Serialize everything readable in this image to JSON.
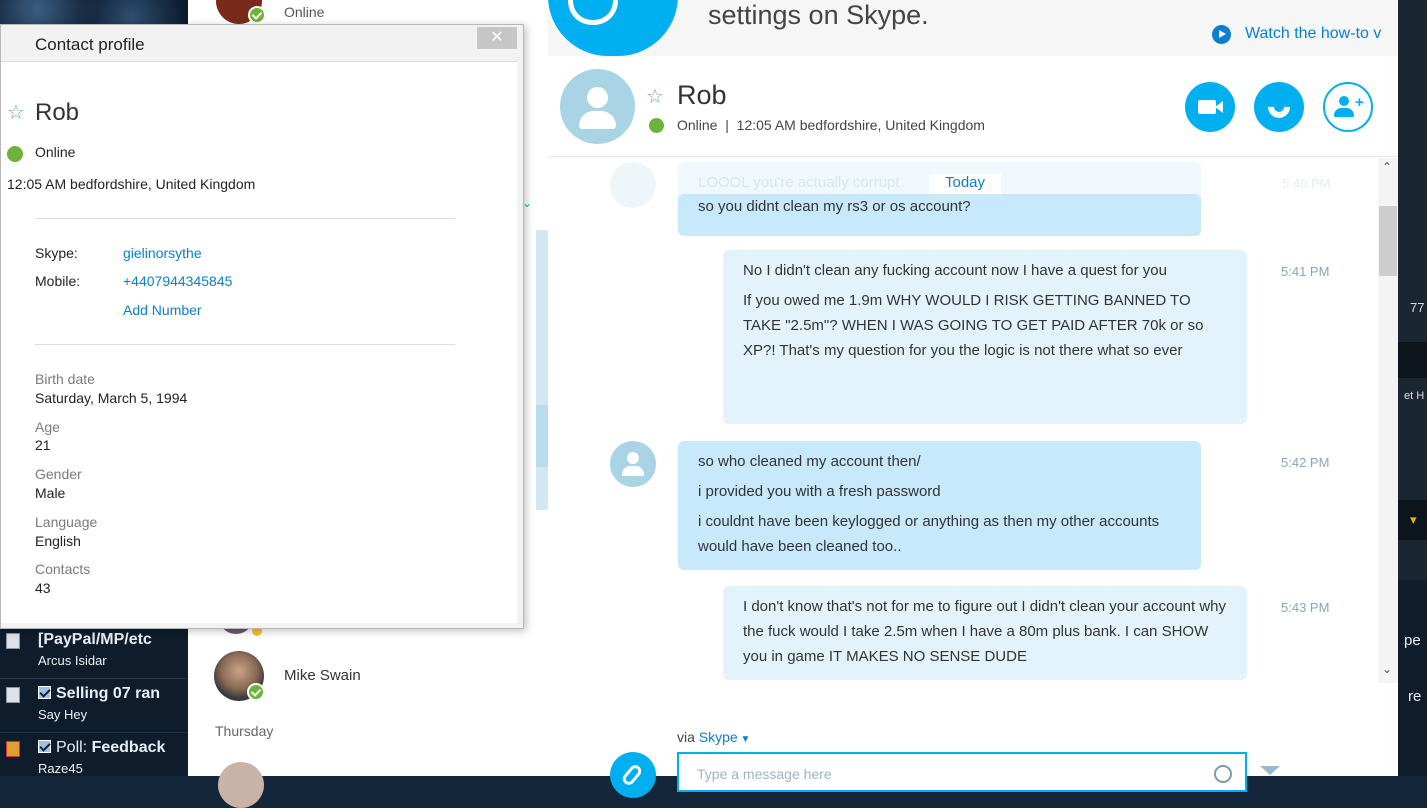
{
  "forum": {
    "rows": [
      {
        "title": "[PayPal/MP/etc",
        "user": "Arcus Isidar",
        "checked": false
      },
      {
        "title": "Selling 07 ran",
        "user": "Say Hey",
        "checked": true
      },
      {
        "title_prefix": "Poll:",
        "title": "Feedback",
        "user": "Raze45",
        "checked": true
      }
    ]
  },
  "contact_list": {
    "top_status": "Online",
    "mike": {
      "name": "Mike Swain"
    },
    "day_header": "Thursday"
  },
  "profile": {
    "window_title": "Contact profile",
    "close_glyph": "✕",
    "star": "☆",
    "name": "Rob",
    "status": "Online",
    "local_info": "12:05 AM bedfordshire, United Kingdom",
    "skype_label": "Skype:",
    "skype_value": "gielinorsythe",
    "mobile_label": "Mobile:",
    "mobile_value": "+4407944345845",
    "add_number": "Add Number",
    "fields": [
      {
        "label": "Birth date",
        "value": "Saturday, March 5, 1994"
      },
      {
        "label": "Age",
        "value": "21"
      },
      {
        "label": "Gender",
        "value": "Male"
      },
      {
        "label": "Language",
        "value": "English"
      },
      {
        "label": "Contacts",
        "value": "43"
      }
    ]
  },
  "banner": {
    "text": "settings on Skype.",
    "watch": "Watch the how-to v"
  },
  "header": {
    "star": "☆",
    "name": "Rob",
    "status_line": "Online  |  12:05 AM bedfordshire, United Kingdom"
  },
  "chat": {
    "faded_text": "LOOOL you're actually corrupt",
    "faded_time": "5:40 PM",
    "today": "Today",
    "messages": [
      {
        "lines": [
          "so you didnt clean my rs3 or os account?"
        ],
        "time": ""
      },
      {
        "lines": [
          "No I didn't clean any fucking account now I have a quest for you",
          "If you owed me 1.9m WHY WOULD I RISK GETTING BANNED TO TAKE \"2.5m\"? WHEN I WAS GOING TO GET PAID AFTER 70k or so XP?! That's my question for you the logic is not there what so ever"
        ],
        "time": "5:41 PM"
      },
      {
        "lines": [
          "so who cleaned my account then/",
          "i provided you with a fresh password",
          "i couldnt have been keylogged or anything as then my other accounts would have been cleaned too.."
        ],
        "time": "5:42 PM"
      },
      {
        "lines": [
          "I don't know that's not for me to figure out I didn't clean your account why the fuck would I take 2.5m when I have a 80m plus bank. I can SHOW you in game IT MAKES NO SENSE DUDE"
        ],
        "time": "5:43 PM"
      }
    ]
  },
  "composer": {
    "via": "via",
    "via_link": "Skype",
    "placeholder": "Type a message here"
  },
  "right_strip": {
    "t1": "77",
    "t2": "et H",
    "t3": "pe",
    "t4": "re"
  },
  "colors": {
    "accent": "#00aff0",
    "online": "#6bb33a",
    "bubble_in": "#c7e9fb",
    "bubble_out": "#e3f3fc"
  }
}
